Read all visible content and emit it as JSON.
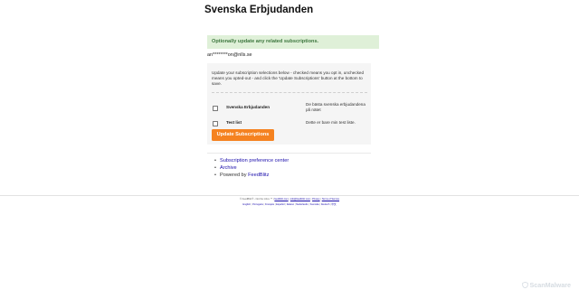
{
  "page": {
    "title": "Svenska Erbjudanden",
    "notice": "Optionally update any related subscriptions.",
    "email": "an********on@nlls.se"
  },
  "subscriptions": {
    "instructions": "Update your subscription selections below - checked means you opt in, unchecked means you opted-out - and click the 'Update Subscriptions' button at the bottom to save.",
    "lists": [
      {
        "name": "Svenska Erbjudanden",
        "description": "De bästa svenska erbjudandena på nätet",
        "checked": false
      },
      {
        "name": "Test list",
        "description": "Dette er bare min test liste.",
        "checked": false
      }
    ],
    "button_label": "Update Subscriptions",
    "button_color": "#f58220"
  },
  "links": {
    "preference_center": "Subscription preference center",
    "archive": "Archive",
    "powered_prefix": "Powered by ",
    "powered_name": "FeedBlitz"
  },
  "footer": {
    "line1_text": "© FeedBlitz® - Not the inbox ™ |",
    "line1_links": [
      "feedblitz.com",
      "info@feedblitz.com",
      "Privacy",
      "Terms of Service"
    ],
    "languages": [
      "English",
      "Português",
      "Français",
      "Español",
      "Italiano",
      "Nederlands",
      "Svenska",
      "Deutsch",
      "中文"
    ]
  },
  "watermark": "ScanMalware",
  "colors": {
    "notice_bg": "#dff0d8",
    "notice_text": "#3c763d",
    "link": "#1a0dab"
  }
}
